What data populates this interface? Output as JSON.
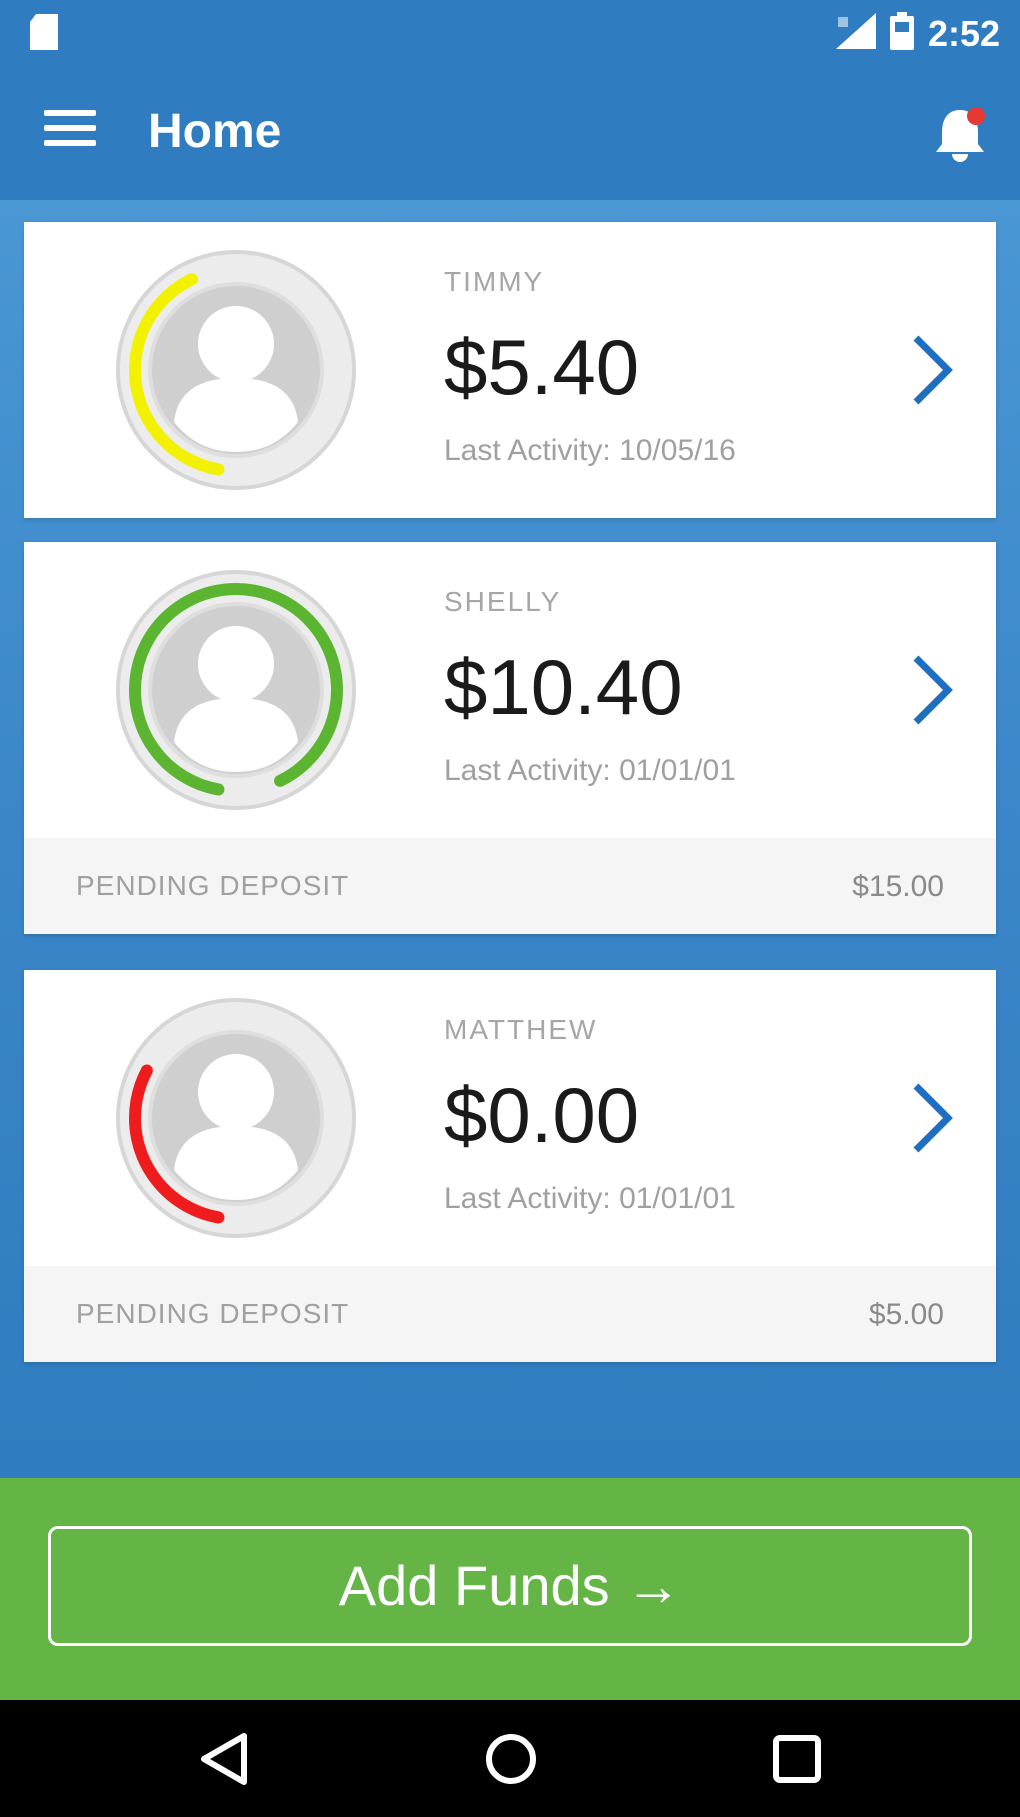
{
  "status_bar": {
    "time": "2:52",
    "icons": [
      "sd-card-icon",
      "signal-icon",
      "battery-icon"
    ]
  },
  "app_bar": {
    "title": "Home",
    "menu_icon": "hamburger-menu-icon",
    "notification_icon": "bell-icon",
    "notification_badge_color": "#e53935"
  },
  "children": [
    {
      "name": "TIMMY",
      "balance": "$5.40",
      "last_activity": "Last Activity: 10/05/16",
      "ring_color": "#f2f200",
      "ring_level": 0.4,
      "pending": null
    },
    {
      "name": "SHELLY",
      "balance": "$10.40",
      "last_activity": "Last Activity: 01/01/01",
      "ring_color": "#5cb531",
      "ring_level": 0.9,
      "pending": {
        "label": "PENDING DEPOSIT",
        "amount": "$15.00"
      }
    },
    {
      "name": "MATTHEW",
      "balance": "$0.00",
      "last_activity": "Last Activity: 01/01/01",
      "ring_color": "#ee1c1c",
      "ring_level": 0.3,
      "pending": {
        "label": "PENDING DEPOSIT",
        "amount": "$5.00"
      }
    }
  ],
  "footer": {
    "add_funds_label": "Add Funds →"
  },
  "colors": {
    "primary": "#2f7cc0",
    "accent_green": "#64b545",
    "chevron": "#1f6fc0"
  },
  "nav_bar": {
    "buttons": [
      "back-icon",
      "home-icon",
      "recents-icon"
    ]
  }
}
